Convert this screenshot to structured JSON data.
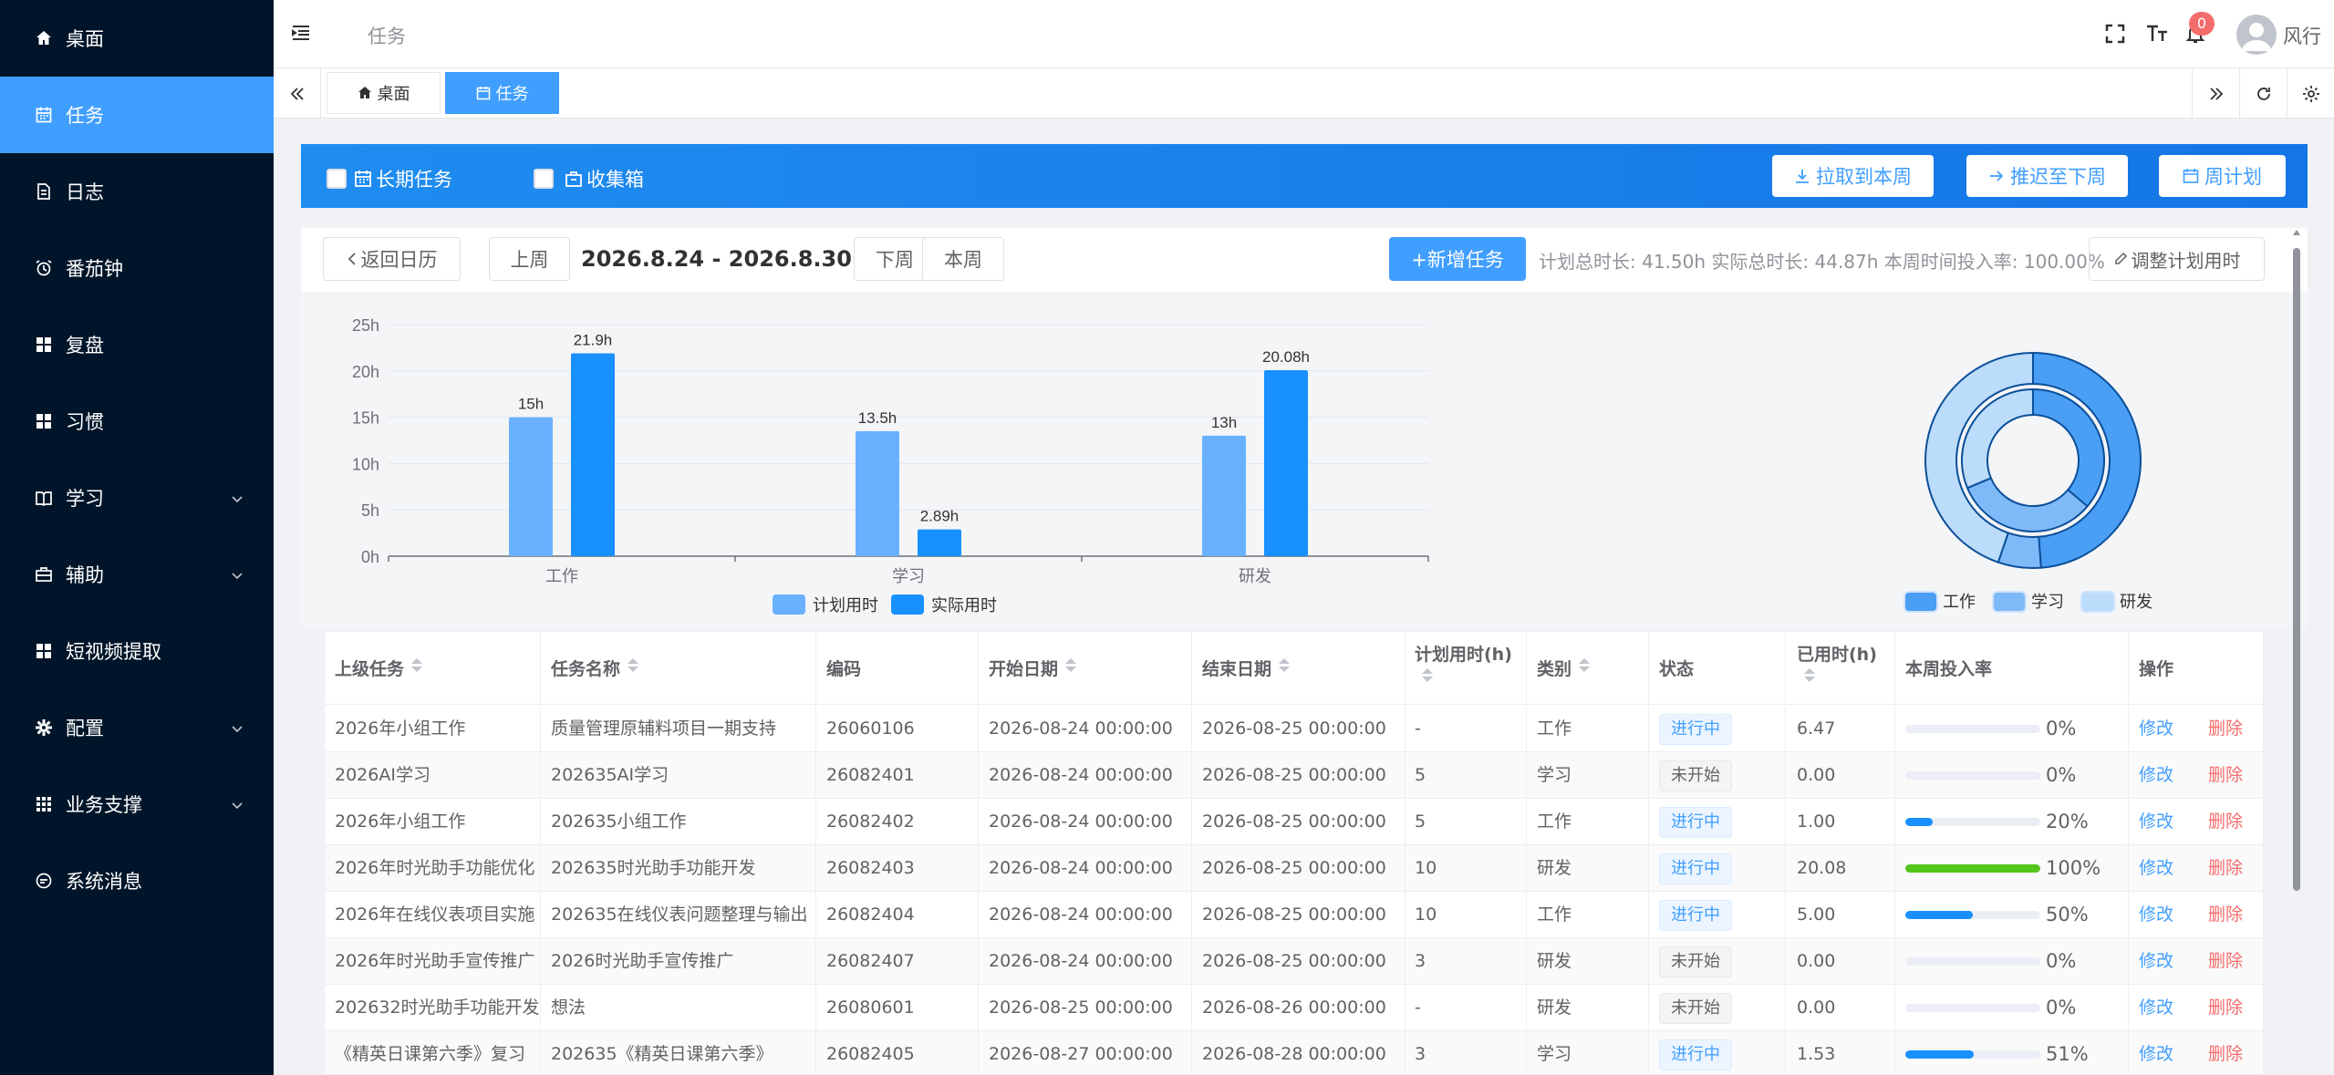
{
  "sidebar": {
    "items": [
      {
        "label": "桌面",
        "icon": "home-icon",
        "active": false,
        "has_children": false
      },
      {
        "label": "任务",
        "icon": "calendar-icon",
        "active": true,
        "has_children": false
      },
      {
        "label": "日志",
        "icon": "document-icon",
        "active": false,
        "has_children": false
      },
      {
        "label": "番茄钟",
        "icon": "alarm-clock-icon",
        "active": false,
        "has_children": false
      },
      {
        "label": "复盘",
        "icon": "grid-icon",
        "active": false,
        "has_children": false
      },
      {
        "label": "习惯",
        "icon": "grid-icon",
        "active": false,
        "has_children": false
      },
      {
        "label": "学习",
        "icon": "book-icon",
        "active": false,
        "has_children": true
      },
      {
        "label": "辅助",
        "icon": "briefcase-icon",
        "active": false,
        "has_children": true
      },
      {
        "label": "短视频提取",
        "icon": "grid-icon",
        "active": false,
        "has_children": false
      },
      {
        "label": "配置",
        "icon": "gear-icon",
        "active": false,
        "has_children": true
      },
      {
        "label": "业务支撑",
        "icon": "apps-icon",
        "active": false,
        "has_children": true
      },
      {
        "label": "系统消息",
        "icon": "chat-icon",
        "active": false,
        "has_children": false
      }
    ]
  },
  "header": {
    "breadcrumb": "任务",
    "notification_count": "0",
    "username": "风行"
  },
  "tabs": [
    {
      "label": "桌面",
      "active": false
    },
    {
      "label": "任务",
      "active": true
    }
  ],
  "toolbar": {
    "long_term_label": "长期任务",
    "inbox_label": "收集箱",
    "pull_label": "拉取到本周",
    "postpone_label": "推迟至下周",
    "weekly_plan_label": "周计划"
  },
  "week": {
    "back_label": "返回日历",
    "prev_label": "上周",
    "range": "2026.8.24 - 2026.8.30",
    "next_label": "下周",
    "current_label": "本周",
    "add_label": "+新增任务",
    "stats": "计划总时长: 41.50h   实际总时长: 44.87h   本周时间投入率: 100.00%",
    "adjust_label": "调整计划用时"
  },
  "chart_data": [
    {
      "type": "bar",
      "categories": [
        "工作",
        "学习",
        "研发"
      ],
      "series": [
        {
          "name": "计划用时",
          "values": [
            15,
            13.5,
            13
          ],
          "labels": [
            "15h",
            "13.5h",
            "13h"
          ],
          "color": "#69b1ff"
        },
        {
          "name": "实际用时",
          "values": [
            21.9,
            2.89,
            20.08
          ],
          "labels": [
            "21.9h",
            "2.89h",
            "20.08h"
          ],
          "color": "#1890ff"
        }
      ],
      "ylim": [
        0,
        25
      ],
      "yticks": [
        "0h",
        "5h",
        "10h",
        "15h",
        "20h",
        "25h"
      ],
      "legend": "bottom"
    },
    {
      "type": "pie",
      "rings": [
        {
          "name": "outer",
          "slices": [
            {
              "label": "工作",
              "value": 21.9
            },
            {
              "label": "学习",
              "value": 2.89
            },
            {
              "label": "研发",
              "value": 20.08
            }
          ]
        },
        {
          "name": "inner",
          "slices": [
            {
              "label": "工作",
              "value": 15
            },
            {
              "label": "学习",
              "value": 13.5
            },
            {
              "label": "研发",
              "value": 13
            }
          ]
        }
      ],
      "legend": [
        {
          "label": "工作",
          "color": "#4a9ff5"
        },
        {
          "label": "学习",
          "color": "#7fbaf8"
        },
        {
          "label": "研发",
          "color": "#bcdcfb"
        }
      ]
    }
  ],
  "table": {
    "headers": [
      "上级任务",
      "任务名称",
      "编码",
      "开始日期",
      "结束日期",
      "计划用时(h)",
      "类别",
      "状态",
      "已用时(h)",
      "本周投入率",
      "操作"
    ],
    "edit_label": "修改",
    "delete_label": "删除",
    "rows": [
      {
        "parent": "2026年小组工作",
        "name": "质量管理原辅料项目一期支持",
        "code": "26060106",
        "start": "2026-08-24 00:00:00",
        "end": "2026-08-25 00:00:00",
        "planned": "-",
        "category": "工作",
        "status": "进行中",
        "used": "6.47",
        "rate": 0,
        "rate_text": "0%"
      },
      {
        "parent": "2026AI学习",
        "name": "202635AI学习",
        "code": "26082401",
        "start": "2026-08-24 00:00:00",
        "end": "2026-08-25 00:00:00",
        "planned": "5",
        "category": "学习",
        "status": "未开始",
        "used": "0.00",
        "rate": 0,
        "rate_text": "0%"
      },
      {
        "parent": "2026年小组工作",
        "name": "202635小组工作",
        "code": "26082402",
        "start": "2026-08-24 00:00:00",
        "end": "2026-08-25 00:00:00",
        "planned": "5",
        "category": "工作",
        "status": "进行中",
        "used": "1.00",
        "rate": 20,
        "rate_text": "20%"
      },
      {
        "parent": "2026年时光助手功能优化",
        "name": "202635时光助手功能开发",
        "code": "26082403",
        "start": "2026-08-24 00:00:00",
        "end": "2026-08-25 00:00:00",
        "planned": "10",
        "category": "研发",
        "status": "进行中",
        "used": "20.08",
        "rate": 100,
        "rate_text": "100%"
      },
      {
        "parent": "2026年在线仪表项目实施",
        "name": "202635在线仪表问题整理与输出",
        "code": "26082404",
        "start": "2026-08-24 00:00:00",
        "end": "2026-08-25 00:00:00",
        "planned": "10",
        "category": "工作",
        "status": "进行中",
        "used": "5.00",
        "rate": 50,
        "rate_text": "50%"
      },
      {
        "parent": "2026年时光助手宣传推广",
        "name": "2026时光助手宣传推广",
        "code": "26082407",
        "start": "2026-08-24 00:00:00",
        "end": "2026-08-25 00:00:00",
        "planned": "3",
        "category": "研发",
        "status": "未开始",
        "used": "0.00",
        "rate": 0,
        "rate_text": "0%"
      },
      {
        "parent": "202632时光助手功能开发",
        "name": "想法",
        "code": "26080601",
        "start": "2026-08-25 00:00:00",
        "end": "2026-08-26 00:00:00",
        "planned": "-",
        "category": "研发",
        "status": "未开始",
        "used": "0.00",
        "rate": 0,
        "rate_text": "0%"
      },
      {
        "parent": "《精英日课第六季》复习",
        "name": "202635《精英日课第六季》",
        "code": "26082405",
        "start": "2026-08-27 00:00:00",
        "end": "2026-08-28 00:00:00",
        "planned": "3",
        "category": "学习",
        "status": "进行中",
        "used": "1.53",
        "rate": 51,
        "rate_text": "51%"
      }
    ]
  }
}
